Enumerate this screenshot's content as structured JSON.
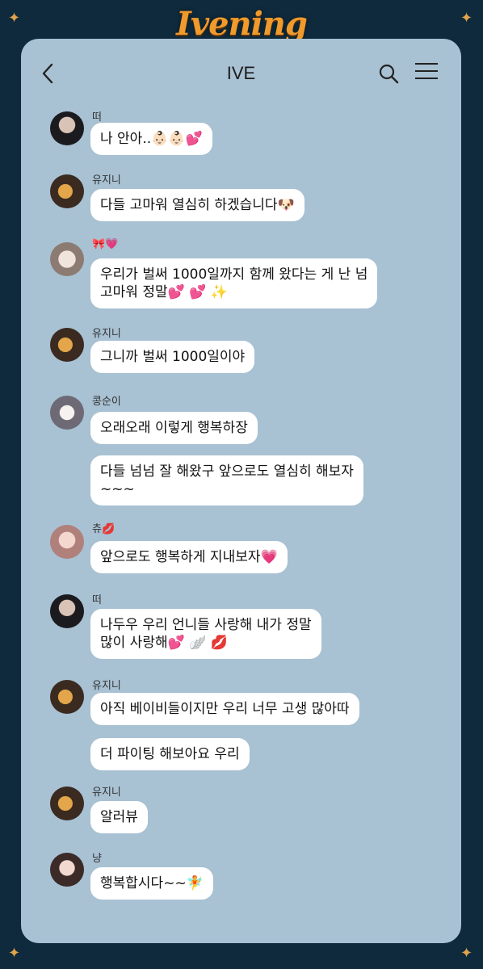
{
  "brand": {
    "logo": "Ivening"
  },
  "chat": {
    "title": "IVE"
  },
  "messages": [
    {
      "sender": "떠",
      "bubbles": [
        "나 안아..👶🏻👶🏻💕"
      ]
    },
    {
      "sender": "유지니",
      "bubbles": [
        "다들 고마워 열심히 하겠습니다🐶"
      ]
    },
    {
      "sender": "🎀💗",
      "bubbles": [
        "우리가 벌써 1000일까지 함께 왔다는 게 난 넘\n고마워 정말💕 💕 ✨"
      ]
    },
    {
      "sender": "유지니",
      "bubbles": [
        "그니까 벌써 1000일이야"
      ]
    },
    {
      "sender": "콩순이",
      "bubbles": [
        "오래오래 이렇게 행복하장",
        "다들 넘넘 잘 해왔구 앞으로도 열심히 해보자\n~~~"
      ]
    },
    {
      "sender": "츄💋",
      "bubbles": [
        "앞으로도 행복하게 지내보자💗"
      ]
    },
    {
      "sender": "떠",
      "bubbles": [
        "나두우 우리 언니들 사랑해 내가 정말\n많이 사랑해💕 🪽 💋"
      ]
    },
    {
      "sender": "유지니",
      "bubbles": [
        "아직 베이비들이지만 우리 너무 고생 많아따",
        "더 파이팅 해보아요 우리"
      ]
    },
    {
      "sender": "유지니",
      "bubbles": [
        "알러뷰"
      ]
    },
    {
      "sender": "냥",
      "bubbles": [
        "행복합시다~~🧚"
      ]
    }
  ],
  "colors": {
    "background": "#0e2a3c",
    "chat_background": "#a8c1d3",
    "bubble": "#ffffff",
    "logo": "#f09a2c"
  },
  "icons": [
    "back-arrow-icon",
    "search-icon",
    "hamburger-menu-icon",
    "sparkle-icon"
  ]
}
